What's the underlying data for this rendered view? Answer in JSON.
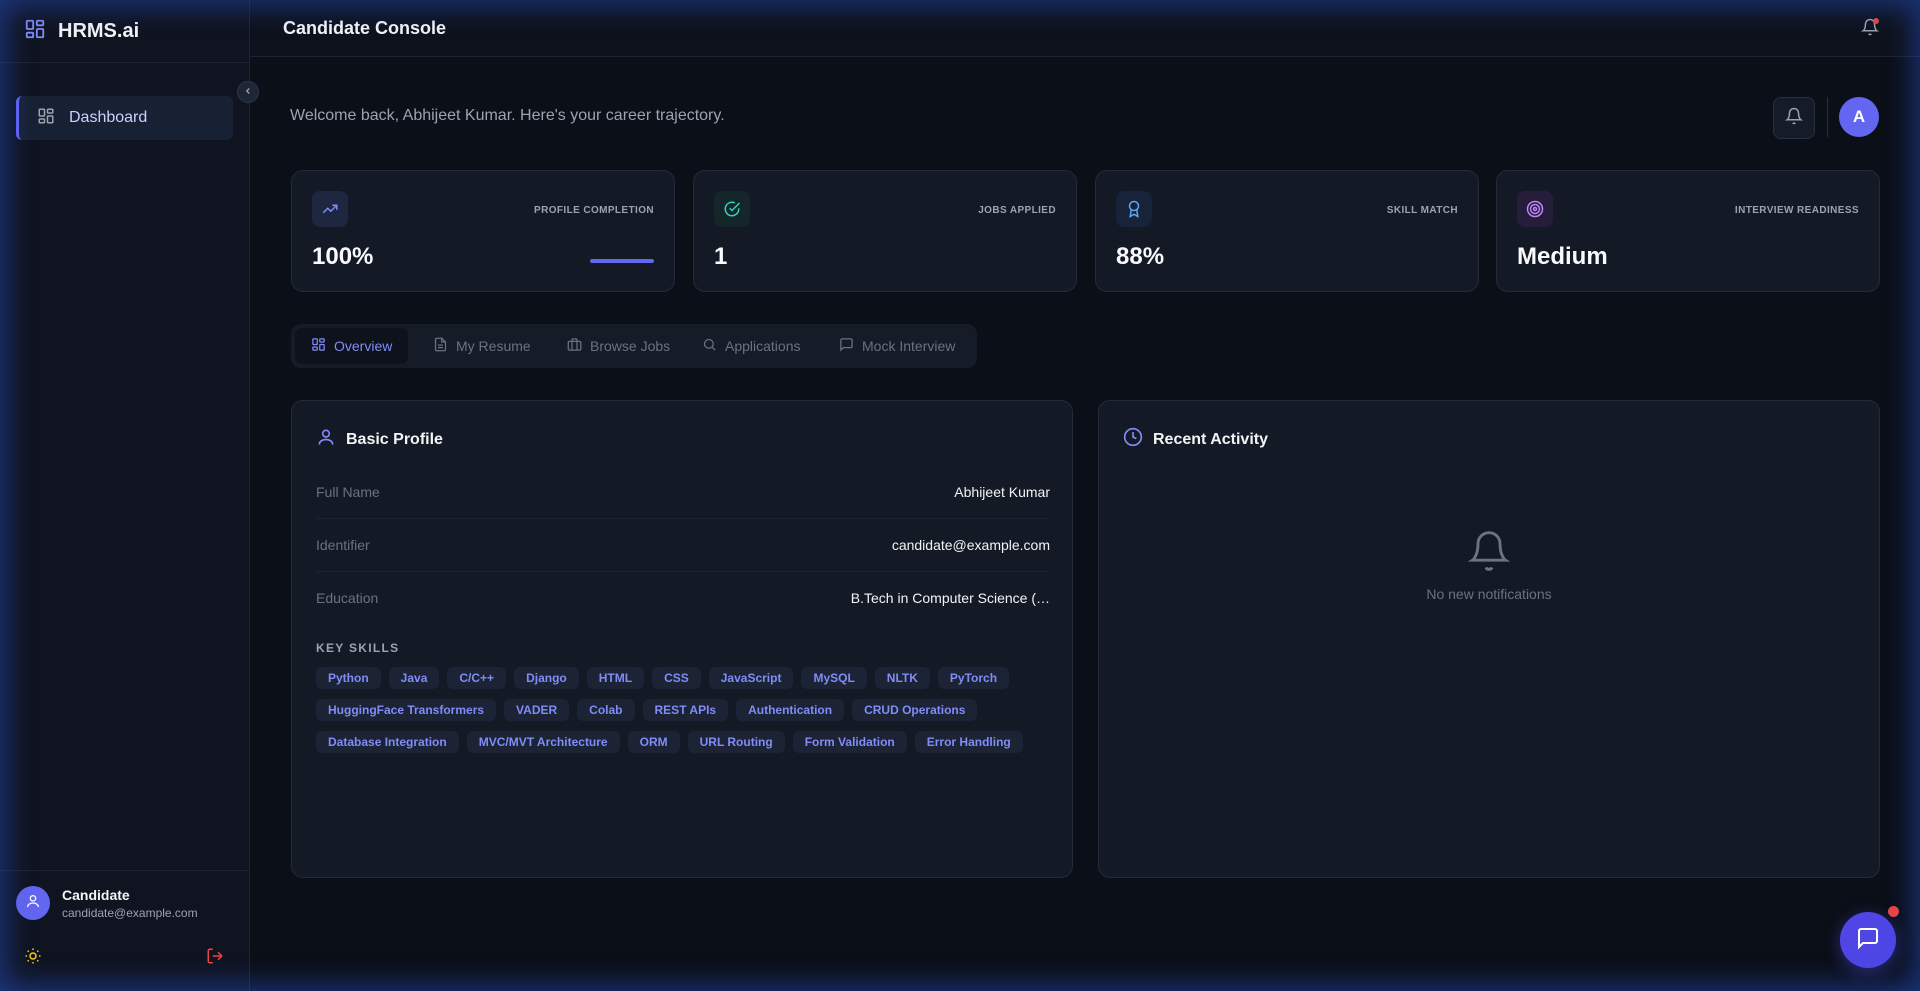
{
  "app": {
    "brand": "HRMS.ai",
    "console_title": "Candidate Console"
  },
  "sidebar": {
    "items": [
      {
        "label": "Dashboard",
        "icon": "dashboard-icon",
        "active": true
      }
    ],
    "user": {
      "name": "Candidate",
      "email": "candidate@example.com"
    }
  },
  "main": {
    "welcome": "Welcome back, Abhijeet Kumar. Here's your career trajectory.",
    "avatar_initial": "A",
    "stats": [
      {
        "label": "PROFILE COMPLETION",
        "value": "100%",
        "progress": 1.0,
        "icon": "trending-up-icon",
        "color": "#6366f1"
      },
      {
        "label": "JOBS APPLIED",
        "value": "1",
        "icon": "check-circle-icon",
        "color": "#2dd4bf"
      },
      {
        "label": "SKILL MATCH",
        "value": "88%",
        "icon": "award-icon",
        "color": "#60a5fa"
      },
      {
        "label": "INTERVIEW READINESS",
        "value": "Medium",
        "icon": "target-icon",
        "color": "#c084fc"
      }
    ],
    "tabs": [
      {
        "label": "Overview",
        "icon": "grid-icon",
        "active": true
      },
      {
        "label": "My Resume",
        "icon": "file-icon"
      },
      {
        "label": "Browse Jobs",
        "icon": "briefcase-icon"
      },
      {
        "label": "Applications",
        "icon": "search-icon"
      },
      {
        "label": "Mock Interview",
        "icon": "message-icon"
      }
    ],
    "profile": {
      "title": "Basic Profile",
      "fields": [
        {
          "label": "Full Name",
          "value": "Abhijeet Kumar"
        },
        {
          "label": "Identifier",
          "value": "candidate@example.com"
        },
        {
          "label": "Education",
          "value": "B.Tech in Computer Science (…"
        }
      ],
      "skills_title": "KEY SKILLS",
      "skills": [
        "Python",
        "Java",
        "C/C++",
        "Django",
        "HTML",
        "CSS",
        "JavaScript",
        "MySQL",
        "NLTK",
        "PyTorch",
        "HuggingFace Transformers",
        "VADER",
        "Colab",
        "REST APIs",
        "Authentication",
        "CRUD Operations",
        "Database Integration",
        "MVC/MVT Architecture",
        "ORM",
        "URL Routing",
        "Form Validation",
        "Error Handling"
      ]
    },
    "activity": {
      "title": "Recent Activity",
      "empty_text": "No new notifications"
    }
  },
  "colors": {
    "accent": "#6366f1",
    "background": "#0b0f17",
    "card": "#131925",
    "notification_dot": "#ef4444"
  }
}
